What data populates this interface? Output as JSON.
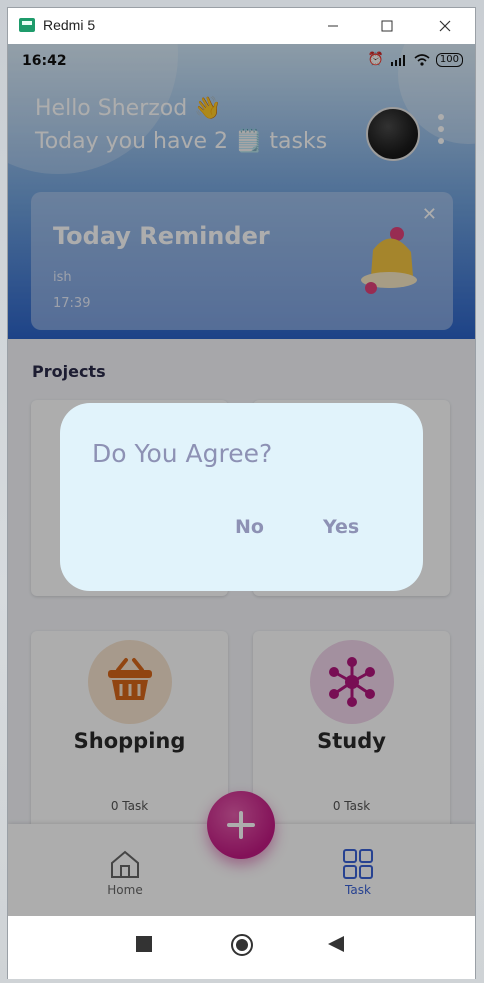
{
  "window": {
    "title": "Redmi 5",
    "minimize": "—",
    "maximize": "☐",
    "close": "✕"
  },
  "status_bar": {
    "time": "16:42",
    "battery": "100"
  },
  "header": {
    "greeting": "Hello Sherzod 👋",
    "task_line": "Today you have 2 🗒️ tasks"
  },
  "reminder": {
    "title": "Today Reminder",
    "subtitle": "ish",
    "time": "17:39",
    "close": "✕"
  },
  "projects": {
    "label": "Projects"
  },
  "categories": [
    {
      "title": "Shopping",
      "count": "0 Task",
      "icon": "basket-icon",
      "bg": "#f7e4cf",
      "accent": "#d6661a"
    },
    {
      "title": "Study",
      "count": "0 Task",
      "icon": "molecule-icon",
      "bg": "#f1d4ea",
      "accent": "#b1157d"
    }
  ],
  "dialog": {
    "title": "Do You Agree?",
    "no": "No",
    "yes": "Yes"
  },
  "bottom_nav": {
    "home": "Home",
    "task": "Task"
  },
  "colors": {
    "fab": "#c21a83",
    "accent_blue": "#3a62d6",
    "dialog_bg": "#e1f3fb",
    "dialog_text": "#8d91b4"
  }
}
